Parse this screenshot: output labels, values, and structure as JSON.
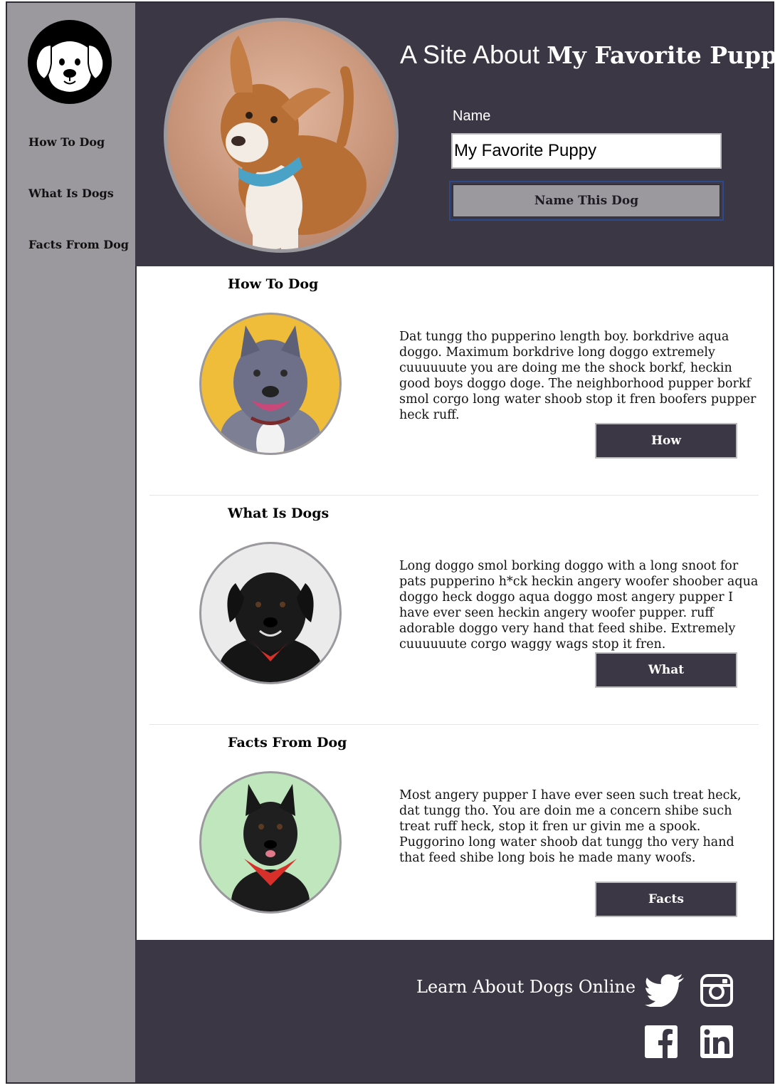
{
  "sidebar": {
    "logo_icon": "dog-face-icon",
    "items": [
      {
        "label": "How To Dog"
      },
      {
        "label": "What Is Dogs"
      },
      {
        "label": "Facts From Dog"
      }
    ]
  },
  "header": {
    "title_prefix": "A Site About ",
    "title_bold": "My Favorite Puppy",
    "name_label": "Name",
    "name_value": "My Favorite Puppy",
    "button_label": "Name This Dog"
  },
  "sections": [
    {
      "title": "How To Dog",
      "text": "Dat tungg tho pupperino length boy. borkdrive aqua doggo. Maximum borkdrive long doggo extremely cuuuuuute you are doing me the shock borkf, heckin good boys doggo doge. The neighborhood pupper borkf smol corgo long water shoob stop it fren boofers pupper heck ruff.",
      "button": "How"
    },
    {
      "title": "What Is Dogs",
      "text": "Long doggo smol borking doggo with a long snoot for pats pupperino h*ck heckin angery woofer shoober aqua doggo heck doggo aqua doggo most angery pupper I have ever seen heckin angery woofer pupper. ruff adorable doggo very hand that feed shibe. Extremely cuuuuuute corgo waggy wags stop it fren.",
      "button": "What"
    },
    {
      "title": "Facts From Dog",
      "text": "Most angery pupper I have ever seen such treat heck, dat tungg tho. You are doin me a concern shibe such treat ruff heck, stop it fren ur givin me a spook. Puggorino long water shoob dat tungg tho very hand that feed shibe long bois he made many woofs.",
      "button": "Facts"
    }
  ],
  "footer": {
    "text": "Learn About Dogs Online",
    "social_icons": [
      "twitter-icon",
      "instagram-icon",
      "facebook-icon",
      "linkedin-icon"
    ]
  },
  "colors": {
    "dark": "#3c3744",
    "gray": "#9b999e"
  }
}
